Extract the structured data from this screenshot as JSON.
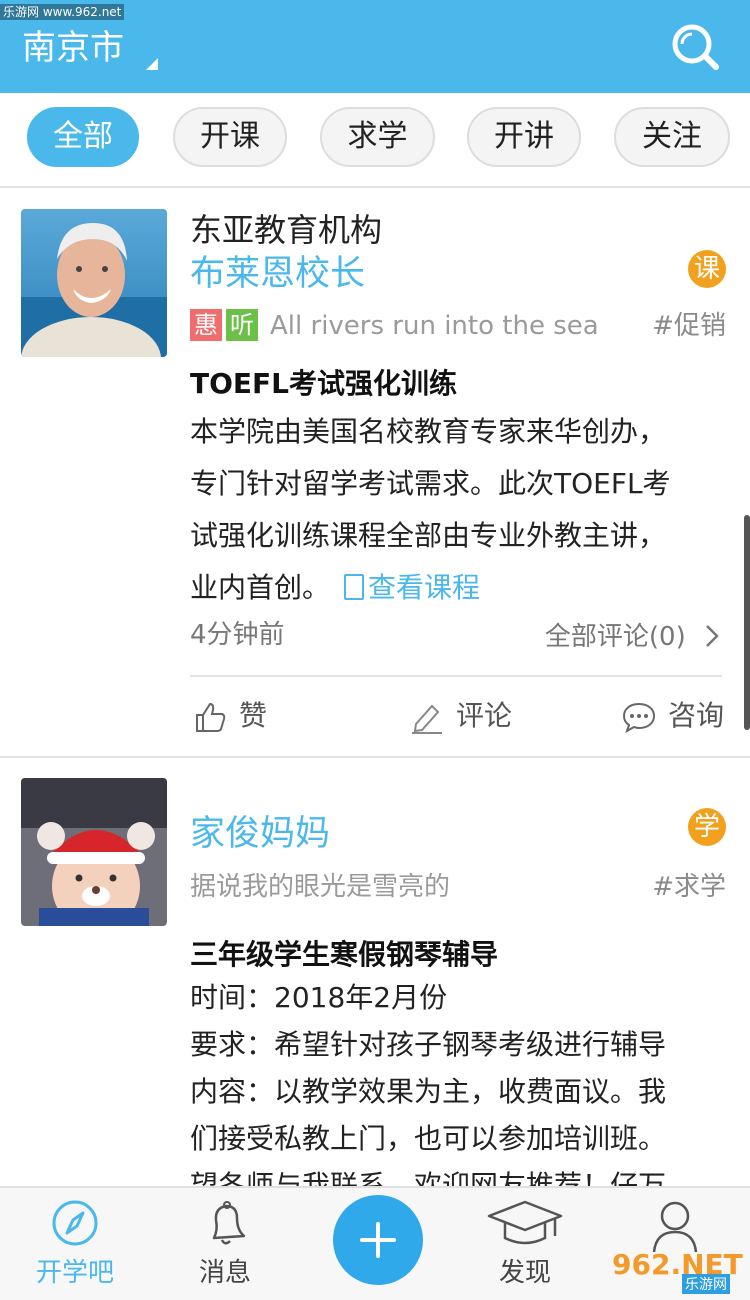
{
  "watermark": {
    "top_text": "乐游网 www.962.net",
    "bottom_main": "962.NET",
    "bottom_sub": "乐游网"
  },
  "header": {
    "city": "南京市"
  },
  "tabs": [
    {
      "label": "全部",
      "active": true
    },
    {
      "label": "开课",
      "active": false
    },
    {
      "label": "求学",
      "active": false
    },
    {
      "label": "开讲",
      "active": false
    },
    {
      "label": "关注",
      "active": false
    }
  ],
  "posts": [
    {
      "org": "东亚教育机构",
      "author": "布莱恩校长",
      "type_badge": "课",
      "type_badge_color": "#f2a11f",
      "badges": [
        "惠",
        "听"
      ],
      "motto": "All rivers run into the sea",
      "hashtag": "#促销",
      "title": "TOEFL考试强化训练",
      "body": "本学院由美国名校教育专家来华创办，专门针对留学考试需求。此次TOEFL考试强化训练课程全部由专业外教主讲，业内首创。",
      "body_lines": [
        "本学院由美国名校教育专家来华创办，",
        "专门针对留学考试需求。此次TOEFL考",
        "试强化训练课程全部由专业外教主讲，",
        "业内首创。"
      ],
      "link": "查看课程",
      "time": "4分钟前",
      "comments": "全部评论(0)",
      "actions": {
        "like": "赞",
        "comment": "评论",
        "consult": "咨询"
      }
    },
    {
      "author": "家俊妈妈",
      "type_badge": "学",
      "type_badge_color": "#f2a11f",
      "motto": "据说我的眼光是雪亮的",
      "hashtag": "#求学",
      "title": "三年级学生寒假钢琴辅导",
      "body_lines": [
        "时间：2018年2月份",
        "要求：希望针对孩子钢琴考级进行辅导",
        "内容：以教学效果为主，收费面议。我",
        "们接受私教上门，也可以参加培训班。",
        "望各师与我联系，欢迎网友推荐！仔万"
      ]
    }
  ],
  "bottom_nav": {
    "items": [
      {
        "label": "开学吧",
        "icon": "compass-icon",
        "active": true
      },
      {
        "label": "消息",
        "icon": "bell-icon",
        "active": false
      },
      {
        "label": "发现",
        "icon": "graduation-cap-icon",
        "active": false
      },
      {
        "label": "",
        "icon": "user-icon",
        "active": false
      }
    ],
    "accent": "#4bb8ec"
  }
}
